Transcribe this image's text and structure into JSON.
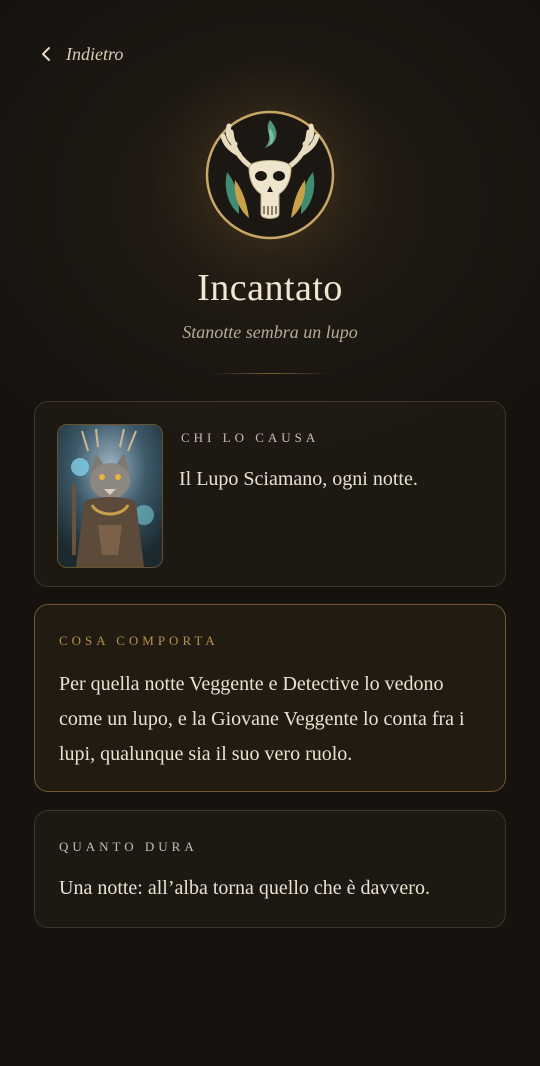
{
  "nav": {
    "back_label": "Indietro"
  },
  "header": {
    "emblem_icon": "deer-skull-feathers-icon",
    "title": "Incantato",
    "subtitle": "Stanotte sembra un lupo"
  },
  "cards": {
    "cause": {
      "heading": "Chi lo causa",
      "text": "Il Lupo Sciamano, ogni notte.",
      "image": "wolf-shaman-portrait"
    },
    "effect": {
      "heading": "Cosa comporta",
      "text": "Per quella notte Veggente e Detective lo vedono come un lupo, e la Giovane Veggente lo conta fra i lupi, qualunque sia il suo vero ruolo."
    },
    "duration": {
      "heading": "Quanto dura",
      "text": "Una notte: all’alba torna quello che è davvero."
    }
  },
  "colors": {
    "background": "#1a1510",
    "accent_gold": "#b8914f",
    "text": "#ebe1cf"
  }
}
